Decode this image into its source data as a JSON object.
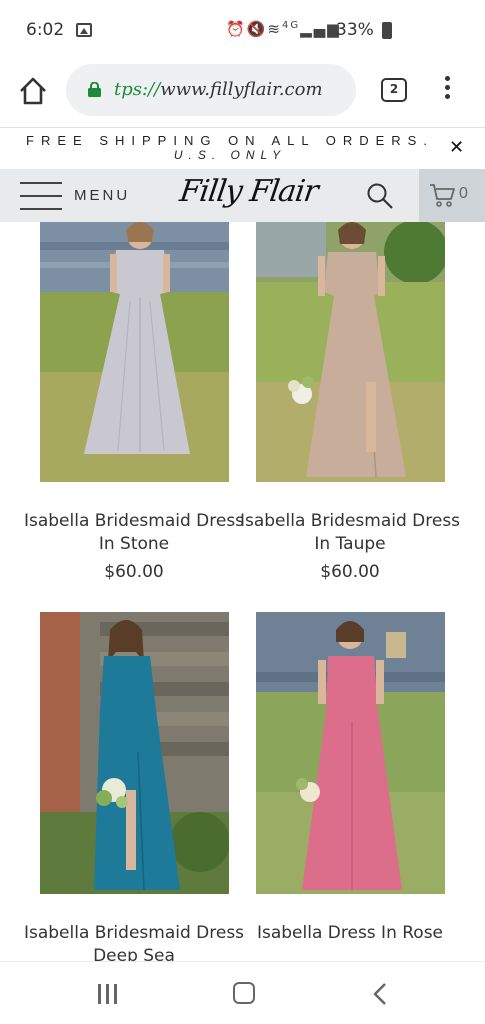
{
  "status_bar": {
    "time": "6:02",
    "network": "4G",
    "battery": "33%"
  },
  "browser": {
    "url_scheme": "tps://",
    "url_host": "www.fillyflair.com",
    "tab_count": "2"
  },
  "promo": {
    "line1": "FREE SHIPPING ON ALL ORDERS.",
    "line2": "U.S. ONLY",
    "close_symbol": "✕"
  },
  "header": {
    "menu_label": "MENU",
    "logo": "Filly Flair",
    "cart_count": "0"
  },
  "products": [
    {
      "name": "Isabella Bridesmaid Dress In Stone",
      "price": "$60.00",
      "dress_color": "#c9c8d0"
    },
    {
      "name": "Isabella Bridesmaid Dress In Taupe",
      "price": "$60.00",
      "dress_color": "#c8ad9a"
    },
    {
      "name": "Isabella Bridesmaid Dress Deep Sea",
      "price": "",
      "dress_color": "#1d7a98"
    },
    {
      "name": "Isabella Dress In Rose",
      "price": "",
      "dress_color": "#dc6e8c"
    }
  ],
  "colors": {
    "header_bg": "#e8eaec",
    "cart_bg": "#cfd4d9",
    "url_secure": "#1e8a3c",
    "grass": "#7f9a4a",
    "barn": "#6f8295"
  }
}
